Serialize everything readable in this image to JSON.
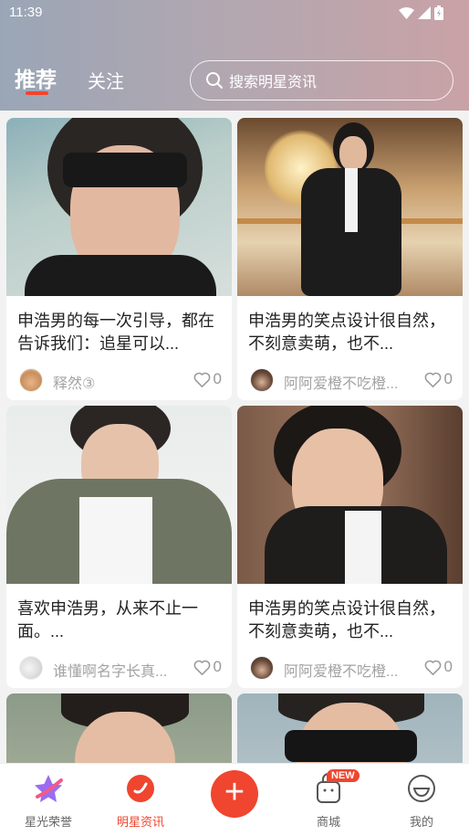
{
  "status_bar": {
    "time": "11:39"
  },
  "tabs": [
    {
      "label": "推荐",
      "active": true
    },
    {
      "label": "关注",
      "active": false
    }
  ],
  "search": {
    "placeholder": "搜索明星资讯"
  },
  "cards": [
    {
      "title": "申浩男的每一次引导，都在告诉我们：追星可以...",
      "author": "释然③",
      "likes": "0"
    },
    {
      "title": "申浩男的笑点设计很自然，不刻意卖萌，也不...",
      "author": "阿阿爱橙不吃橙...",
      "likes": "0"
    },
    {
      "title": "喜欢申浩男，从来不止一面。...",
      "author": "谁懂啊名字长真...",
      "likes": "0"
    },
    {
      "title": "申浩男的笑点设计很自然，不刻意卖萌，也不...",
      "author": "阿阿爱橙不吃橙...",
      "likes": "0"
    }
  ],
  "bottom_nav": [
    {
      "label": "星光荣誉",
      "icon": "star-icon"
    },
    {
      "label": "明星资讯",
      "icon": "news-icon",
      "active": true
    },
    {
      "label": "",
      "icon": "plus-icon"
    },
    {
      "label": "商城",
      "icon": "shop-bag-icon",
      "badge": "NEW"
    },
    {
      "label": "我的",
      "icon": "profile-icon"
    }
  ],
  "colors": {
    "accent": "#f0452f"
  }
}
